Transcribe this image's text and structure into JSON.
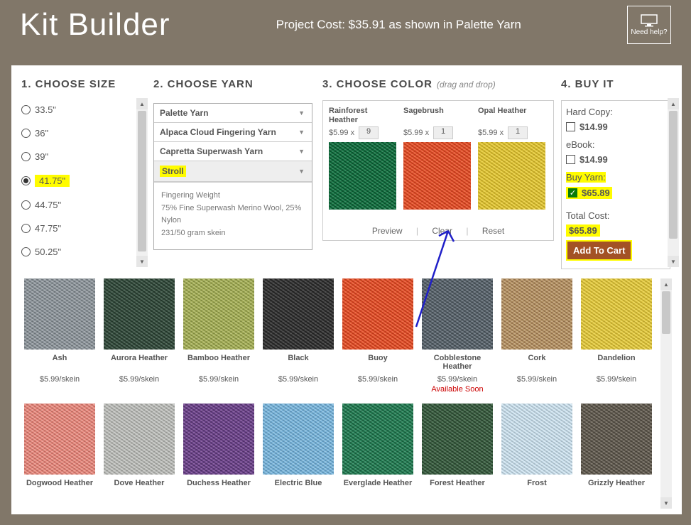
{
  "header": {
    "title": "Kit Builder",
    "cost_line": "Project Cost: $35.91 as shown in Palette Yarn",
    "help_label": "Need help?"
  },
  "step1": {
    "title": "1. CHOOSE SIZE",
    "options": [
      "33.5\"",
      "36\"",
      "39\"",
      "41.75\"",
      "44.75\"",
      "47.75\"",
      "50.25\""
    ],
    "selected_index": 3
  },
  "step2": {
    "title": "2. CHOOSE YARN",
    "options": [
      "Palette Yarn",
      "Alpaca Cloud Fingering Yarn",
      "Capretta Superwash Yarn",
      "Stroll"
    ],
    "selected_index": 3,
    "desc_lines": [
      "Fingering Weight",
      "75% Fine Superwash Merino Wool, 25% Nylon",
      "231/50 gram skein"
    ]
  },
  "step3": {
    "title": "3. CHOOSE COLOR",
    "hint": "(drag and drop)",
    "slots": [
      {
        "name": "Rainforest Heather",
        "price": "$5.99 x",
        "qty": "9",
        "color": "#0b6b3a"
      },
      {
        "name": "Sagebrush",
        "price": "$5.99 x",
        "qty": "1",
        "color": "#e84b22"
      },
      {
        "name": "Opal Heather",
        "price": "$5.99 x",
        "qty": "1",
        "color": "#e6c92f"
      }
    ],
    "actions": {
      "preview": "Preview",
      "clear": "Clear",
      "reset": "Reset"
    }
  },
  "step4": {
    "title": "4. BUY IT",
    "hardcopy_label": "Hard Copy:",
    "hardcopy_price": "$14.99",
    "ebook_label": "eBook:",
    "ebook_price": "$14.99",
    "buyyarn_label": "Buy Yarn:",
    "buyyarn_price": "$65.89",
    "total_label": "Total Cost:",
    "total_price": "$65.89",
    "add_cart": "Add To Cart"
  },
  "palette": {
    "row1": [
      {
        "name": "Ash",
        "price": "$5.99/skein",
        "color": "#8f979d"
      },
      {
        "name": "Aurora Heather",
        "price": "$5.99/skein",
        "color": "#2d4636"
      },
      {
        "name": "Bamboo Heather",
        "price": "$5.99/skein",
        "color": "#a6b155"
      },
      {
        "name": "Black",
        "price": "$5.99/skein",
        "color": "#2b2b2b"
      },
      {
        "name": "Buoy",
        "price": "$5.99/skein",
        "color": "#e84b22"
      },
      {
        "name": "Cobblestone Heather",
        "price": "$5.99/skein",
        "color": "#56616a",
        "avail": "Available Soon"
      },
      {
        "name": "Cork",
        "price": "$5.99/skein",
        "color": "#b89363"
      },
      {
        "name": "Dandelion",
        "price": "$5.99/skein",
        "color": "#e7cd3a"
      }
    ],
    "row2": [
      {
        "name": "Dogwood Heather",
        "color": "#ec8a7e"
      },
      {
        "name": "Dove Heather",
        "color": "#bfc1bd"
      },
      {
        "name": "Duchess Heather",
        "color": "#6b3f8a"
      },
      {
        "name": "Electric Blue",
        "color": "#7ab8e0"
      },
      {
        "name": "Everglade Heather",
        "color": "#1d7a4f"
      },
      {
        "name": "Forest Heather",
        "color": "#33583a"
      },
      {
        "name": "Frost",
        "color": "#cfe5f2"
      },
      {
        "name": "Grizzly Heather",
        "color": "#5f584c"
      }
    ]
  }
}
